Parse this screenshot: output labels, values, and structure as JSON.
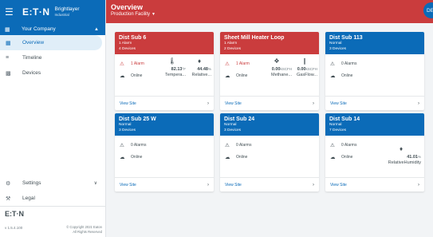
{
  "app": {
    "menu_icon": "menu-icon",
    "logo_text": "E:T·N",
    "logo_brand": "Brightlayer",
    "logo_suite": "Industrial",
    "company": "Your Company",
    "header_title": "Overview",
    "header_subtitle": "Production Facility",
    "avatar_initials": "DE",
    "colors": {
      "primary": "#0b6bb8",
      "alarm": "#ca3c3d"
    }
  },
  "nav": {
    "items": [
      {
        "label": "Overview",
        "icon": "grid-icon"
      },
      {
        "label": "Timeline",
        "icon": "list-icon"
      },
      {
        "label": "Devices",
        "icon": "device-icon"
      }
    ],
    "settings": "Settings",
    "legal": "Legal"
  },
  "footer": {
    "logo": "E:T·N",
    "version": "v 1.5.4.100",
    "copyright_line1": "© Copyright 2021 Eaton",
    "copyright_line2": "All Rights Reserved"
  },
  "cards": [
    {
      "name": "Dist Sub 6",
      "line1": "1 Alarm",
      "line2": "4 Devices",
      "status": "alarm",
      "alarms": "1 Alarm",
      "online": "Online",
      "metrics": [
        {
          "icon": "thermometer-icon",
          "value": "82.13",
          "unit": "°F",
          "label": "Tempera..."
        },
        {
          "icon": "humidity-icon",
          "value": "44.48",
          "unit": "%",
          "label": "Relative..."
        }
      ],
      "view": "View Site"
    },
    {
      "name": "Sheet Mill Heater Loop",
      "line1": "1 Alarm",
      "line2": "2 Devices",
      "status": "alarm",
      "alarms": "1 Alarm",
      "online": "Online",
      "metrics": [
        {
          "icon": "methane-icon",
          "value": "0.00",
          "unit": "kSCFH",
          "label": "Methane..."
        },
        {
          "icon": "gasflow-icon",
          "value": "0.00",
          "unit": "kSCFH",
          "label": "GasFlow..."
        }
      ],
      "view": "View Site"
    },
    {
      "name": "Dist Sub 113",
      "line1": "Normal",
      "line2": "3 Devices",
      "status": "normal",
      "alarms": "0 Alarms",
      "online": "Online",
      "metrics": [],
      "view": "View Site"
    },
    {
      "name": "Dist Sub 25 W",
      "line1": "Normal",
      "line2": "3 Devices",
      "status": "normal",
      "alarms": "0 Alarms",
      "online": "Online",
      "metrics": [],
      "view": "View Site"
    },
    {
      "name": "Dist Sub 24",
      "line1": "Normal",
      "line2": "3 Devices",
      "status": "normal",
      "alarms": "0 Alarms",
      "online": "Online",
      "metrics": [],
      "view": "View Site"
    },
    {
      "name": "Dist Sub 14",
      "line1": "Normal",
      "line2": "7 Devices",
      "status": "normal",
      "alarms": "0 Alarms",
      "online": "Online",
      "metrics": [
        {
          "icon": "humidity-icon",
          "value": "41.01",
          "unit": "%",
          "label": "RelativeHumidity"
        }
      ],
      "view": "View Site"
    }
  ]
}
